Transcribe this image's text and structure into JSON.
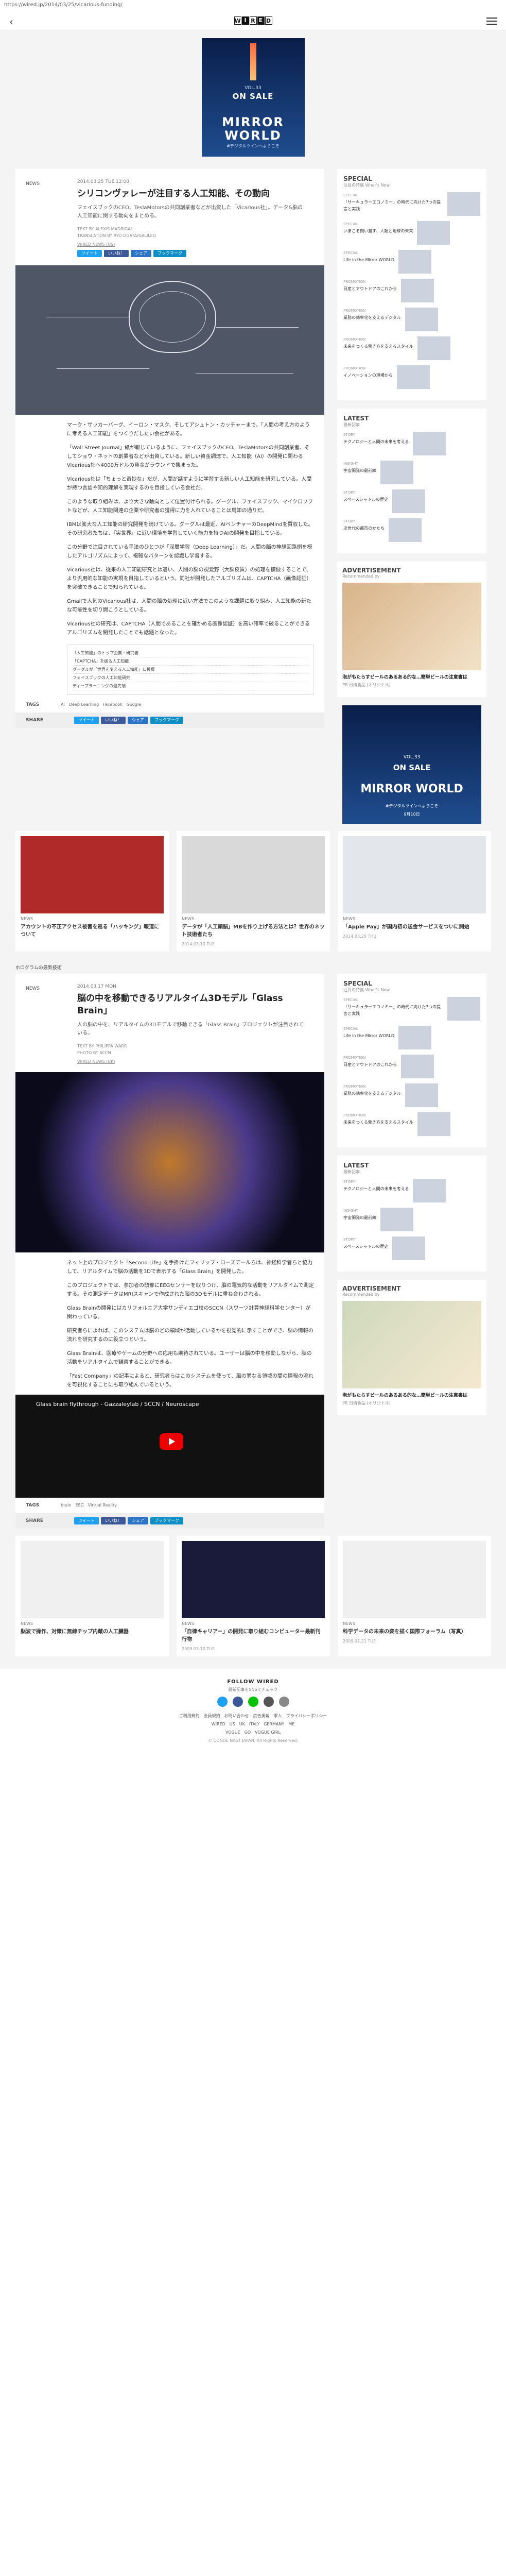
{
  "url": "https://wired.jp/2014/03/25/vicarious-funding/",
  "logo": [
    "W",
    "I",
    "R",
    "E",
    "D"
  ],
  "topad": {
    "vol": "VOL.33",
    "onsale": "ON SALE",
    "title": "MIRROR WORLD",
    "sub": "#デジタルツインへようこそ",
    "date": "9月10日"
  },
  "article1": {
    "category": "NEWS",
    "date": "2014.03.25 TUE 12:00",
    "title": "シリコンヴァレーが注目する人工知能、その動向",
    "lead": "フェイスブックのCEO、TeslaMotorsの共同創業者などが出資した「Vicarious社」。データ&脳の人工知能に関する動向をまとめる。",
    "credit1": "TEXT BY ALEXIS MADRIGAL",
    "credit2": "TRANSLATION BY RYO OGATA/GALILEO",
    "credit3": "WIRED NEWS (US)",
    "paragraphs": [
      "マーク・ザッカーバーグ、イーロン・マスク、そしてアシュトン・カッチャーまで。「人間の考え方のように考える人工知能」をつくりだしたい会社がある。",
      "「Wall Street Journal」紙が報じているように、フェイスブックのCEO、TeslaMotorsの共同創業者、そしてショウ・ネットの創業者などが出資している。新しい資金調達で、人工知能（AI）の開発に関わるVicarious社へ4000万ドルの資金がラウンドで集まった。",
      "Vicarious社は「ちょっと奇妙な」だが、人間が話すように学習する新しい人工知能を研究している。人間が持つ言語や知的理解を実現するのを目指している会社だ。",
      "このような取り組みは、より大きな動向として位置付けられる。グーグル、フェイスブック、マイクロソフトなどが、人工知能関連の企業や研究者の獲得に力を入れていることは周知の通りだ。",
      "IBMは膨大な人工知能の研究開発を続けている。グーグルは最近、AIベンチャーのDeepMindを買収した。その研究者たちは、『実世界』に近い環境を学習していく能力を持つAIの開発を目指している。",
      "この分野で注目されている手法のひとつが「深層学習（Deep Learning）」だ。人間の脳の神経回路網を模したアルゴリズムによって、複雑なパターンを認識し学習する。",
      "Vicarious社は、従来の人工知能研究とは違い、人間の脳の視覚野（大脳皮質）の処理を模倣することで、より汎用的な知能の実現を目指しているという。同社が開発したアルゴリズムは、CAPTCHA（画像認証）を突破できることで知られている。",
      "Gmailで人気のVicarious社は、人間の脳の処理に近い方法でこのような課題に取り組み、人工知能の新たな可能性を切り開こうとしている。",
      "Vicarious社の研究は、CAPTCHA（人間であることを確かめる画像認証）を高い確率で破ることができるアルゴリズムを開発したことでも話題となった。"
    ],
    "related": [
      "「人工知能」のトップ企業・研究者",
      "「CAPTCHA」を破る人工知能",
      "グーグルが「世界を変える人工知能」に投資",
      "フェイスブックの人工知能研究",
      "ディープラーニングの最先端"
    ],
    "tags_label": "TAGS",
    "tags": [
      "AI",
      "Deep Learning",
      "Facebook",
      "Google"
    ],
    "share_label": "SHARE",
    "share": [
      "ツイート",
      "いいね！",
      "シェア",
      "ブックマーク"
    ]
  },
  "sidebar1": {
    "special_title": "SPECIAL",
    "special_sub": "注目の特集 What's Now",
    "special_items": [
      {
        "label": "SPECIAL",
        "text": "「サーキュラーエコノミー」の時代に向けた7つの提言と実践"
      },
      {
        "label": "SPECIAL",
        "text": "いまこそ問い直す、人類と地球の未来"
      },
      {
        "label": "SPECIAL",
        "text": "Life in the Mirror WORLD"
      },
      {
        "label": "PROMOTION",
        "text": "日産とアウトドアのこれから"
      },
      {
        "label": "PROMOTION",
        "text": "業務の効率化を支えるデジタル"
      },
      {
        "label": "PROMOTION",
        "text": "未来をつくる働き方を支えるスタイル"
      },
      {
        "label": "PROMOTION",
        "text": "イノベーションの現場から"
      }
    ],
    "latest_title": "LATEST",
    "latest_sub": "最新記事",
    "latest_items": [
      {
        "label": "STORY",
        "text": "テクノロジーと人間の未来を考える"
      },
      {
        "label": "INSIGHT",
        "text": "宇宙開発の最前線"
      },
      {
        "label": "STORY",
        "text": "スペースシャトルの歴史"
      },
      {
        "label": "STORY",
        "text": "次世代の都市のかたち"
      }
    ],
    "ad_title": "ADVERTISEMENT",
    "ad_sub": "Recommended by",
    "ad_text": "泡がもたらすビールのあるある的な…簡単ビールの注意書は",
    "ad_source": "PR 日清食品 (オリジナル)"
  },
  "cards1": [
    {
      "tag": "NEWS",
      "text": "アカウントの不正アクセス被害を巡る「ハッキング」報道について",
      "date": ""
    },
    {
      "tag": "NEWS",
      "text": "データが「人工頭脳」MBを作り上げる方法とは？世界のネット技術者たち",
      "date": "2014.03.10 TUE"
    },
    {
      "tag": "NEWS",
      "text": "「Apple Pay」が国内初の送金サービスをついに開始",
      "date": "2014.03.20 THU"
    }
  ],
  "article2": {
    "breadcrumb": "ホログラムの最新技術",
    "category": "NEWS",
    "date": "2014.03.17 MON",
    "title": "脳の中を移動できるリアルタイム3Dモデル「Glass Brain」",
    "lead": "人の脳の中を、リアルタイムの3Dモデルで移動できる「Glass Brain」プロジェクトが注目されている。",
    "credit1": "TEXT BY PHILIPPA WARR",
    "credit2": "PHOTO BY SCCN",
    "credit3": "WIRED NEWS (UK)",
    "paragraphs": [
      "ネット上のプロジェクト「Second Life」を手掛けたフィリップ・ローズデールらは、神経科学者らと協力して、リアルタイムで脳の活動を3Dで表示する「Glass Brain」を開発した。",
      "このプロジェクトでは、参加者の頭部にEEGセンサーを取りつけ、脳の電気的な活動をリアルタイムで測定する。その測定データはMRIスキャンで作成された脳の3Dモデルに重ね合わされる。",
      "Glass Brainの開発にはカリフォルニア大学サンディエゴ校のSCCN（スワーツ計算神経科学センター）が関わっている。",
      "研究者らによれば、このシステムは脳のどの領域が活動しているかを視覚的に示すことができ、脳の情報の流れを研究するのに役立つという。",
      "Glass Brainは、医療やゲームの分野への応用も期待されている。ユーザーは脳の中を移動しながら、脳の活動をリアルタイムで観察することができる。",
      "「Fast Company」の記事によると、研究者らはこのシステムを使って、脳の異なる領域の間の情報の流れを可視化することにも取り組んでいるという。"
    ],
    "video_title": "Glass brain flythrough - Gazzaleylab / SCCN / Neuroscape",
    "tags_label": "TAGS",
    "tags": [
      "brain",
      "EEG",
      "Virtual Reality"
    ],
    "share_label": "SHARE",
    "share": [
      "ツイート",
      "いいね！",
      "シェア",
      "ブックマーク"
    ]
  },
  "cards2": [
    {
      "tag": "NEWS",
      "text": "脳波で操作、対策に無線チップ内蔵の人工臓器",
      "date": ""
    },
    {
      "tag": "NEWS",
      "text": "「自律キャリアー」の開発に取り組むコンピューター最新刊行物",
      "date": "2009.03.10 TUE"
    },
    {
      "tag": "NEWS",
      "text": "科学データの未来の姿を描く国際フォーラム（写真）",
      "date": "2009.07.21 TUE"
    }
  ],
  "footer": {
    "follow": "FOLLOW WIRED",
    "follow_sub": "最新記事をSNSでチェック",
    "links1": "ご利用規約　会員規約　お問い合わせ　広告掲載　求人　プライバシーポリシー",
    "links2": "WIRED　US　UK　ITALY　GERMANY　ME",
    "links3": "VOGUE　GQ　VOGUE GIRL",
    "copyright": "© CONDÉ NAST JAPAN. All Rights Reserved."
  }
}
